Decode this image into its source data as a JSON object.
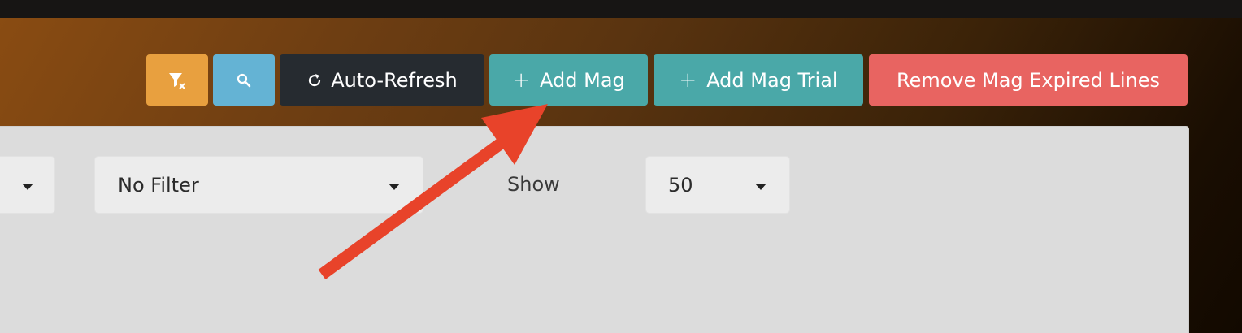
{
  "toolbar": {
    "clear_filter_icon": "filter-clear-icon",
    "search_icon": "search-icon",
    "auto_refresh_label": "Auto-Refresh",
    "add_mag_label": "Add Mag",
    "add_mag_trial_label": "Add Mag Trial",
    "remove_expired_label": "Remove Mag Expired Lines",
    "plus_glyph": "+",
    "colors": {
      "filter": "#e8a03f",
      "search": "#64b3d4",
      "refresh": "#262b30",
      "add": "#4aa8a8",
      "remove": "#e86461"
    }
  },
  "filters": {
    "status_filter_value": "No Filter",
    "show_label": "Show",
    "page_size_value": "50"
  },
  "annotation": {
    "arrow_color": "#e8432a"
  }
}
